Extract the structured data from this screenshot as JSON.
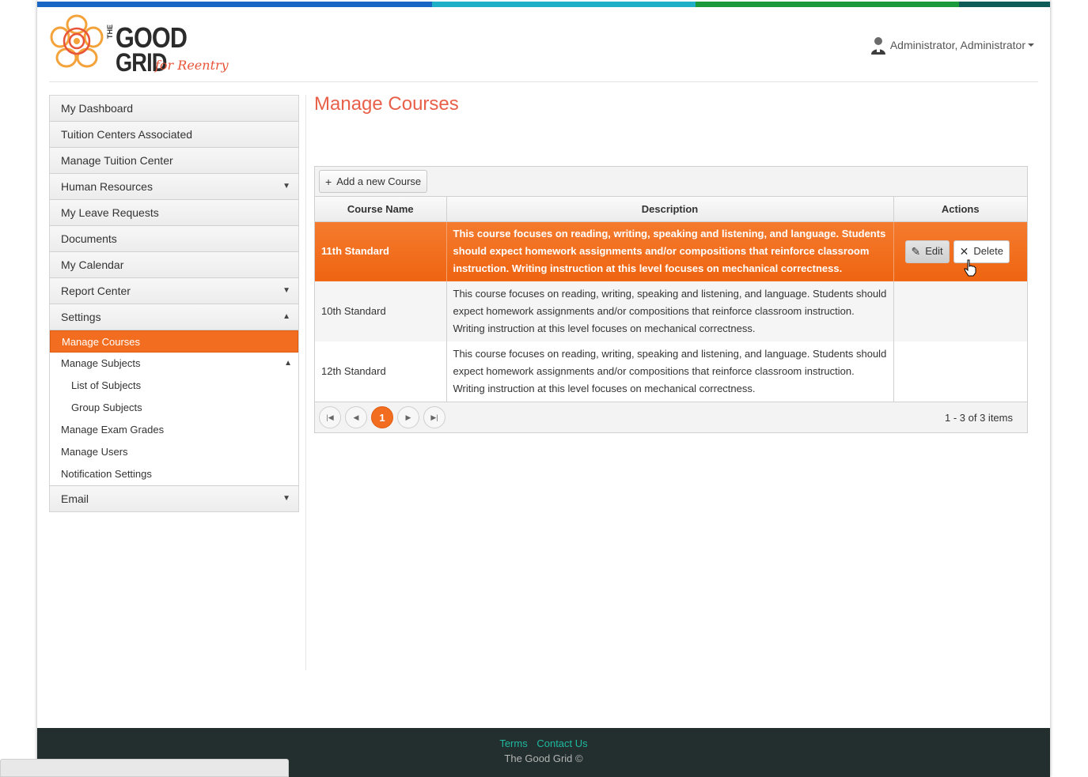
{
  "colors": {
    "accent": "#f26d1f",
    "title": "#e8604a",
    "footer_bg": "#232f2e",
    "footer_link": "#1fb8a0",
    "topbar": [
      "#1a66c4",
      "#1fb0c7",
      "#1b9a3c",
      "#0f5b57"
    ]
  },
  "logo": {
    "the": "THE",
    "good": "GOOD",
    "grid": "GRID",
    "tagline": "for Reentry"
  },
  "user_menu": {
    "label": "Administrator, Administrator",
    "icon": "user-avatar-icon"
  },
  "sidebar": {
    "items": [
      {
        "label": "My Dashboard"
      },
      {
        "label": "Tuition Centers Associated"
      },
      {
        "label": "Manage Tuition Center"
      },
      {
        "label": "Human Resources",
        "arrow": "▼"
      },
      {
        "label": "My Leave Requests"
      },
      {
        "label": "Documents"
      },
      {
        "label": "My Calendar"
      },
      {
        "label": "Report Center",
        "arrow": "▼"
      },
      {
        "label": "Settings",
        "arrow": "▲"
      }
    ],
    "settings_sub": [
      {
        "label": "Manage Courses"
      },
      {
        "label": "Manage Subjects",
        "arrow": "▲"
      },
      {
        "label": "List of Subjects"
      },
      {
        "label": "Group Subjects"
      },
      {
        "label": "Manage Exam Grades"
      },
      {
        "label": "Manage Users"
      },
      {
        "label": "Notification Settings"
      }
    ],
    "email": {
      "label": "Email",
      "arrow": "▼"
    }
  },
  "main": {
    "title": "Manage Courses",
    "add_button": "Add a new Course",
    "columns": [
      "Course Name",
      "Description",
      "Actions"
    ],
    "rows": [
      {
        "name": "11th Standard",
        "description": "This course focuses on reading, writing, speaking and listening, and language. Students should expect homework assignments and/or compositions that reinforce classroom instruction. Writing instruction at this level focuses on mechanical correctness.",
        "selected": true
      },
      {
        "name": "10th Standard",
        "description": "This course focuses on reading, writing, speaking and listening, and language. Students should expect homework assignments and/or compositions that reinforce classroom instruction. Writing instruction at this level focuses on mechanical correctness."
      },
      {
        "name": "12th Standard",
        "description": "This course focuses on reading, writing, speaking and listening, and language. Students should expect homework assignments and/or compositions that reinforce classroom instruction. Writing instruction at this level focuses on mechanical correctness."
      }
    ],
    "edit_label": "Edit",
    "delete_label": "Delete",
    "pager": {
      "current_page": "1",
      "info": "1 - 3 of 3 items"
    }
  },
  "footer": {
    "terms": "Terms",
    "contact": "Contact Us",
    "copyright": "The Good Grid ©"
  }
}
